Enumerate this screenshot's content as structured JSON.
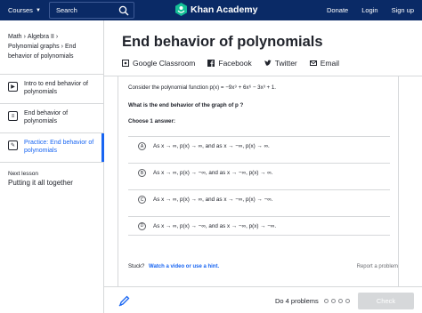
{
  "topnav": {
    "courses_label": "Courses",
    "search_placeholder": "Search",
    "logo_text": "Khan Academy",
    "donate": "Donate",
    "login": "Login",
    "signup": "Sign up"
  },
  "sidebar": {
    "breadcrumb": [
      "Math",
      "Algebra II",
      "Polynomial graphs",
      "End behavior of polynomials"
    ],
    "items": [
      {
        "label": "Intro to end behavior of polynomials",
        "icon": "video-icon"
      },
      {
        "label": "End behavior of polynomials",
        "icon": "article-icon"
      },
      {
        "label": "Practice: End behavior of polynomials",
        "icon": "practice-pencil-icon"
      }
    ],
    "next_lesson_label": "Next lesson",
    "next_lesson_title": "Putting it all together"
  },
  "main": {
    "title": "End behavior of polynomials",
    "share": [
      "Google Classroom",
      "Facebook",
      "Twitter",
      "Email"
    ]
  },
  "question": {
    "prompt": "Consider the polynomial function p(x) = −9x⁹ + 6x⁶ − 3x³ + 1.",
    "ask": "What is the end behavior of the graph of p ?",
    "choose": "Choose 1 answer:",
    "choices": [
      {
        "letter": "A",
        "text": "As x → ∞, p(x) → ∞, and as x → −∞, p(x) → ∞."
      },
      {
        "letter": "B",
        "text": "As x → ∞, p(x) → −∞, and as x → −∞, p(x) → ∞."
      },
      {
        "letter": "C",
        "text": "As x → ∞, p(x) → ∞, and as x → −∞, p(x) → −∞."
      },
      {
        "letter": "D",
        "text": "As x → ∞, p(x) → −∞, and as x → −∞, p(x) → −∞."
      }
    ],
    "stuck_label": "Stuck?",
    "stuck_link": "Watch a video or use a hint.",
    "report": "Report a problem"
  },
  "bottombar": {
    "progress_text": "Do 4 problems",
    "progress_done": 0,
    "progress_total": 4,
    "check_label": "Check"
  },
  "colors": {
    "nav_bg": "#0a2a66",
    "accent": "#1865f2",
    "disabled_button": "#d6d8da"
  }
}
